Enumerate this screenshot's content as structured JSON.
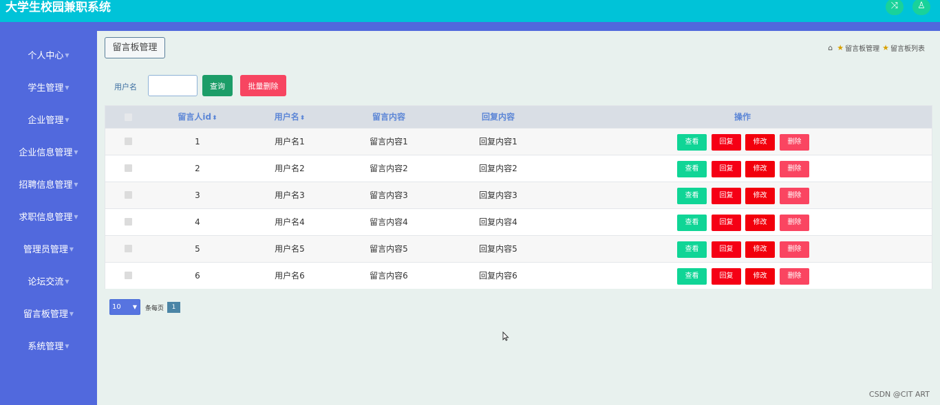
{
  "app": {
    "title": "大学生校园兼职系统",
    "icon_shuffle": "shuffle-icon",
    "icon_user": "user-icon"
  },
  "sidebar": {
    "items": [
      {
        "label": "个人中心"
      },
      {
        "label": "学生管理"
      },
      {
        "label": "企业管理"
      },
      {
        "label": "企业信息管理"
      },
      {
        "label": "招聘信息管理"
      },
      {
        "label": "求职信息管理"
      },
      {
        "label": "管理员管理"
      },
      {
        "label": "论坛交流"
      },
      {
        "label": "留言板管理"
      },
      {
        "label": "系统管理"
      }
    ]
  },
  "page": {
    "title": "留言板管理"
  },
  "breadcrumb": {
    "items": [
      "留言板管理",
      "留言板列表"
    ]
  },
  "search": {
    "label": "用户名",
    "value": "",
    "query_button": "查询",
    "batch_delete_button": "批量删除"
  },
  "table": {
    "headers": {
      "id": "留言人id",
      "username": "用户名",
      "content": "留言内容",
      "reply": "回复内容",
      "actions": "操作"
    },
    "rows": [
      {
        "id": "1",
        "username": "用户名1",
        "content": "留言内容1",
        "reply": "回复内容1"
      },
      {
        "id": "2",
        "username": "用户名2",
        "content": "留言内容2",
        "reply": "回复内容2"
      },
      {
        "id": "3",
        "username": "用户名3",
        "content": "留言内容3",
        "reply": "回复内容3"
      },
      {
        "id": "4",
        "username": "用户名4",
        "content": "留言内容4",
        "reply": "回复内容4"
      },
      {
        "id": "5",
        "username": "用户名5",
        "content": "留言内容5",
        "reply": "回复内容5"
      },
      {
        "id": "6",
        "username": "用户名6",
        "content": "留言内容6",
        "reply": "回复内容6"
      }
    ],
    "actions": {
      "view": "查看",
      "reply": "回复",
      "edit": "修改",
      "delete": "删除"
    }
  },
  "pagination": {
    "page_size": "10",
    "per_page_label": "条每页",
    "current_page": "1"
  },
  "watermark": "CSDN @CIT ART",
  "colors": {
    "topbar": "#00c3d8",
    "sidebar": "#5169dd",
    "view": "#10d596",
    "reply": "#f50015",
    "edit": "#f2000c",
    "delete": "#fa4561"
  }
}
